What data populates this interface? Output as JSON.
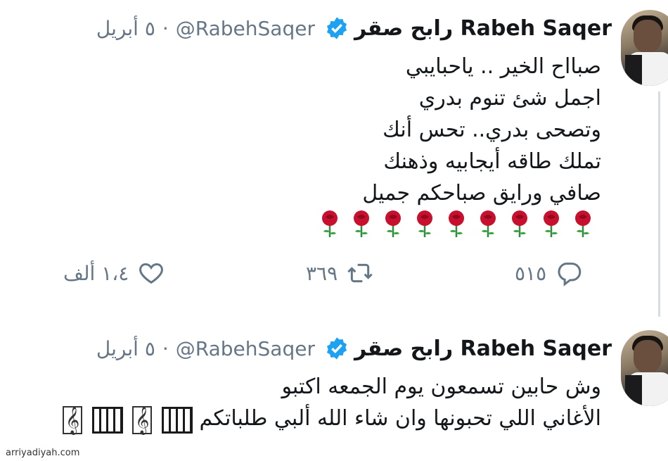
{
  "tweets": [
    {
      "author_name": "رابح صقر Rabeh Saqer",
      "handle": "@RabehSaqer",
      "date": "٥ أبريل",
      "text_lines": [
        "صبااح الخير .. ياحبايبي",
        "اجمل شئ تنوم بدري",
        "وتصحى بدري.. تحس أنك",
        "تملك طاقه أيجابيه وذهنك",
        "صافي ورايق صباحكم جميل"
      ],
      "rose_count": 9,
      "actions": {
        "reply_count": "٥١٥",
        "retweet_count": "٣٦٩",
        "like_count": "١،٤ ألف"
      }
    },
    {
      "author_name": "رابح صقر Rabeh Saqer",
      "handle": "@RabehSaqer",
      "date": "٥ أبريل",
      "text_lines": [
        "وش حابين تسمعون يوم الجمعه اكتبو",
        "الأغاني اللي تحبونها وان شاء الله ألبي طلباتكم"
      ]
    }
  ],
  "icons": {
    "verified": "verified-badge-icon",
    "reply": "reply-icon",
    "retweet": "retweet-icon",
    "like": "heart-icon",
    "rose": "rose-emoji-icon",
    "piano": "piano-emoji-icon",
    "clef": "treble-clef-emoji-icon"
  },
  "colors": {
    "verified_blue": "#1da1f2",
    "muted_text": "#657786",
    "rose_red": "#c8102e"
  },
  "watermark": "arriyadiyah.com"
}
